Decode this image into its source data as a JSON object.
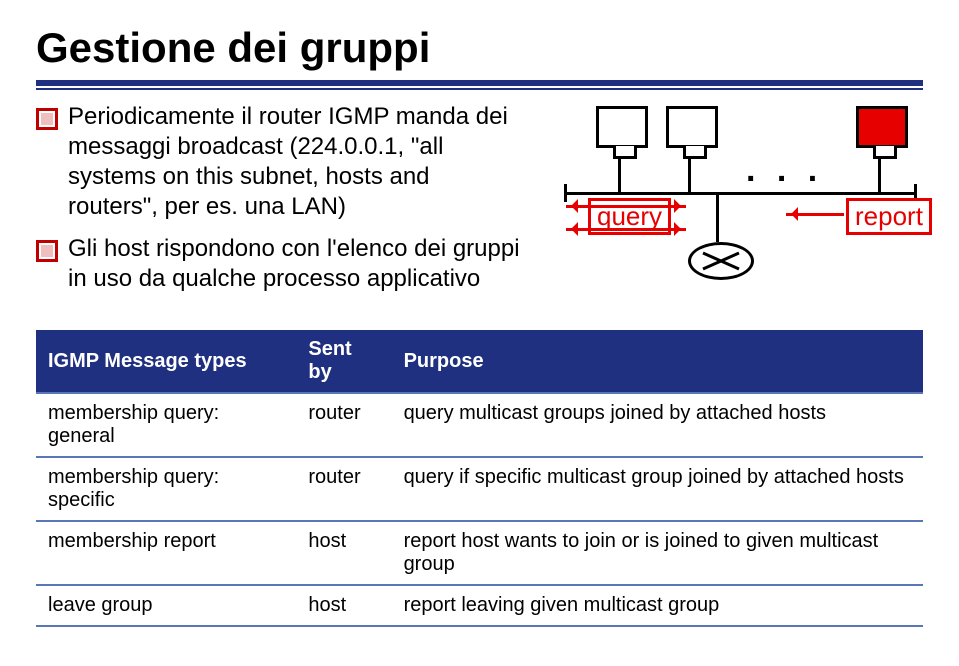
{
  "title": "Gestione dei gruppi",
  "bullets": [
    "Periodicamente il router IGMP manda dei messaggi broadcast (224.0.0.1, \"all systems on this subnet, hosts and routers\", per es. una LAN)",
    "Gli host rispondono con l'elenco dei gruppi in uso da qualche processo applicativo"
  ],
  "diagram": {
    "query_label": "query",
    "report_label": "report",
    "dots": ". . ."
  },
  "table": {
    "headers": [
      "IGMP Message types",
      "Sent by",
      "Purpose"
    ],
    "rows": [
      {
        "type": "membership query: general",
        "sentby": "router",
        "purpose": "query multicast groups joined by attached hosts"
      },
      {
        "type": "membership query: specific",
        "sentby": "router",
        "purpose": "query if specific multicast group joined by attached hosts"
      },
      {
        "type": "membership report",
        "sentby": "host",
        "purpose": "report host wants to join or is joined to given multicast group"
      },
      {
        "type": "leave group",
        "sentby": "host",
        "purpose": "report leaving given multicast group"
      }
    ]
  }
}
